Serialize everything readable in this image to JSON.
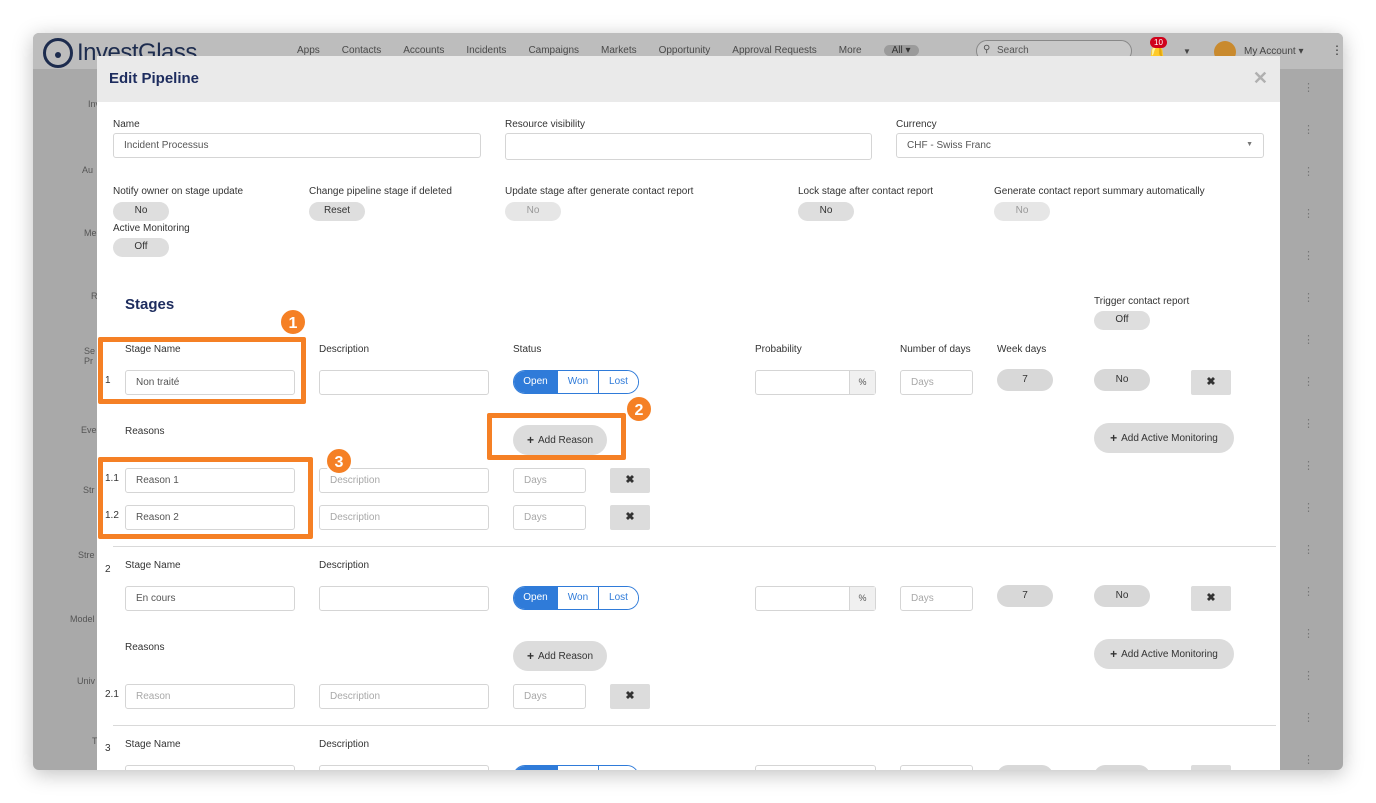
{
  "app": {
    "logo_text": "InvestGlass",
    "nav": [
      "Apps",
      "Contacts",
      "Accounts",
      "Incidents",
      "Campaigns",
      "Markets",
      "Opportunity",
      "Approval Requests",
      "More"
    ],
    "all_label": "All ▾",
    "search_placeholder": "Search",
    "notification_count": "10",
    "account_label": "My Account ▾",
    "side_labels": [
      "Inv",
      "Au",
      "Me",
      "R",
      "Se Pr",
      "Eve",
      "Str",
      "Stre",
      "Model",
      "Univ",
      "T"
    ]
  },
  "modal": {
    "title": "Edit Pipeline",
    "close": "✕",
    "name_label": "Name",
    "name_value": "Incident Processus",
    "resource_label": "Resource visibility",
    "resource_value": "",
    "currency_label": "Currency",
    "currency_value": "CHF - Swiss Franc",
    "notify_label": "Notify owner on stage update",
    "notify_value": "No",
    "change_label": "Change pipeline stage if deleted",
    "change_value": "Reset",
    "update_label": "Update stage after generate contact report",
    "update_value": "No",
    "lock_label": "Lock stage after contact report",
    "lock_value": "No",
    "generate_label": "Generate contact report summary automatically",
    "generate_value": "No",
    "active_label": "Active Monitoring",
    "active_value": "Off",
    "stages_heading": "Stages",
    "trigger_label": "Trigger contact report",
    "trigger_value": "Off"
  },
  "stage_headers": {
    "stage_name": "Stage Name",
    "description": "Description",
    "status": "Status",
    "probability": "Probability",
    "days": "Number of days",
    "week": "Week days",
    "reasons": "Reasons",
    "add_reason": "Add Reason",
    "add_monitoring": "Add Active Monitoring",
    "pct": "%",
    "days_placeholder": "Days",
    "desc_placeholder": "Description",
    "status_open": "Open",
    "status_won": "Won",
    "status_lost": "Lost",
    "remove": "✖"
  },
  "stages": [
    {
      "index": "1",
      "name": "Non traité",
      "week_days": "7",
      "no": "No",
      "reasons": [
        {
          "index": "1.1",
          "name": "Reason 1"
        },
        {
          "index": "1.2",
          "name": "Reason 2"
        }
      ]
    },
    {
      "index": "2",
      "name": "En cours",
      "week_days": "7",
      "no": "No",
      "reasons": [
        {
          "index": "2.1",
          "name": "Reason"
        }
      ]
    },
    {
      "index": "3"
    }
  ],
  "annotations": [
    "1",
    "2",
    "3"
  ],
  "colors": {
    "accent": "#2f7bd9",
    "highlight": "#f58025",
    "title": "#1d2c5e"
  }
}
